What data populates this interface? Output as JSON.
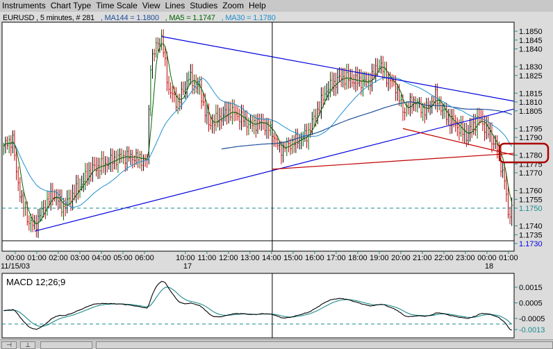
{
  "menu": [
    "Instruments",
    "Chart Type",
    "Time Scale",
    "View",
    "Lines",
    "Studies",
    "Zoom",
    "Help"
  ],
  "info": {
    "symbol": "EURUSD , 5 minutes, # 281",
    "ma144": ", MA144 = 1.1800",
    "ma5": ", MA5 = 1.1747",
    "ma30": ", MA30 = 1.1780"
  },
  "colors": {
    "ma144": "#1f4e9a",
    "ma5": "#006400",
    "ma30": "#1e8fcf",
    "up": "#006400",
    "down": "#c00000",
    "trend": "#0000e0",
    "support": "#c00000",
    "macd": "#000000",
    "signal": "#1a8a8a",
    "highlight": "#aa0000"
  },
  "price_axis": {
    "ticks": [
      "1.1850",
      "1.1845",
      "1.1840",
      "1.1830",
      "1.1825",
      "1.1815",
      "1.1810",
      "1.1805",
      "1.1795",
      "1.1790",
      "1.1780",
      "1.1775",
      "1.1770",
      "1.1760",
      "1.1755",
      "1.1750",
      "1.1740",
      "1.1735",
      "1.1730"
    ],
    "last_price": "1.1750",
    "line_price": "1.1730"
  },
  "time_axis": {
    "labels": [
      [
        "00:00",
        0
      ],
      [
        "01:00",
        1
      ],
      [
        "02:00",
        2
      ],
      [
        "03:00",
        3
      ],
      [
        "04:00",
        4
      ],
      [
        "05:00",
        5
      ],
      [
        "06:00",
        6
      ],
      [
        "10:00",
        7.9
      ],
      [
        "11:00",
        8.9
      ],
      [
        "12:00",
        9.9
      ],
      [
        "13:00",
        10.9
      ],
      [
        "14:00",
        11.9
      ],
      [
        "15:00",
        12.9
      ],
      [
        "16:00",
        13.9
      ],
      [
        "17:00",
        14.9
      ],
      [
        "18:00",
        15.9
      ],
      [
        "19:00",
        16.9
      ],
      [
        "20:00",
        17.9
      ],
      [
        "21:00",
        18.9
      ],
      [
        "22:00",
        19.9
      ],
      [
        "23:00",
        20.9
      ],
      [
        "00:00",
        21.9
      ],
      [
        "01:00",
        22.9
      ]
    ],
    "dates": [
      [
        "11/15/03",
        -0.5
      ],
      [
        "17",
        7.9
      ],
      [
        "18",
        21.9
      ]
    ]
  },
  "bars": 281,
  "price_path": [
    [
      0,
      1.1785
    ],
    [
      5,
      1.1789
    ],
    [
      7,
      1.177
    ],
    [
      10,
      1.1754
    ],
    [
      14,
      1.1742
    ],
    [
      17,
      1.174
    ],
    [
      22,
      1.175
    ],
    [
      27,
      1.1758
    ],
    [
      33,
      1.175
    ],
    [
      37,
      1.1756
    ],
    [
      43,
      1.1764
    ],
    [
      48,
      1.1772
    ],
    [
      56,
      1.1775
    ],
    [
      64,
      1.1779
    ],
    [
      71,
      1.1779
    ],
    [
      79,
      1.1777
    ],
    [
      81,
      1.1832
    ],
    [
      85,
      1.1844
    ],
    [
      87,
      1.1846
    ],
    [
      91,
      1.1817
    ],
    [
      96,
      1.1809
    ],
    [
      102,
      1.1824
    ],
    [
      108,
      1.1817
    ],
    [
      113,
      1.1797
    ],
    [
      119,
      1.1801
    ],
    [
      125,
      1.1805
    ],
    [
      131,
      1.1801
    ],
    [
      136,
      1.1797
    ],
    [
      142,
      1.1799
    ],
    [
      148,
      1.1793
    ],
    [
      152,
      1.1783
    ],
    [
      159,
      1.1787
    ],
    [
      167,
      1.1791
    ],
    [
      172,
      1.1803
    ],
    [
      178,
      1.1817
    ],
    [
      186,
      1.1824
    ],
    [
      194,
      1.1822
    ],
    [
      201,
      1.1821
    ],
    [
      207,
      1.1832
    ],
    [
      211,
      1.1824
    ],
    [
      216,
      1.1819
    ],
    [
      220,
      1.1805
    ],
    [
      226,
      1.1811
    ],
    [
      232,
      1.1805
    ],
    [
      238,
      1.1813
    ],
    [
      243,
      1.1803
    ],
    [
      249,
      1.1797
    ],
    [
      255,
      1.1791
    ],
    [
      262,
      1.1801
    ],
    [
      268,
      1.1791
    ],
    [
      272,
      1.1783
    ],
    [
      276,
      1.1766
    ],
    [
      278,
      1.1746
    ],
    [
      280,
      1.175
    ]
  ],
  "trend_lines": [
    {
      "color": "trend",
      "from": [
        87,
        1.1847
      ],
      "to": [
        281,
        1.18105
      ]
    },
    {
      "color": "trend",
      "from": [
        17,
        1.1737
      ],
      "to": [
        281,
        1.1806
      ]
    },
    {
      "color": "support",
      "from": [
        148,
        1.1772
      ],
      "to": [
        281,
        1.1781
      ]
    },
    {
      "color": "support",
      "from": [
        220,
        1.1795
      ],
      "to": [
        281,
        1.178
      ]
    }
  ],
  "crosshair_bar": 148,
  "macd": {
    "title": "MACD 12;26;9",
    "ticks": [
      "0.0015",
      "0.0005",
      "-0.0005"
    ],
    "current": "-0.0013"
  }
}
